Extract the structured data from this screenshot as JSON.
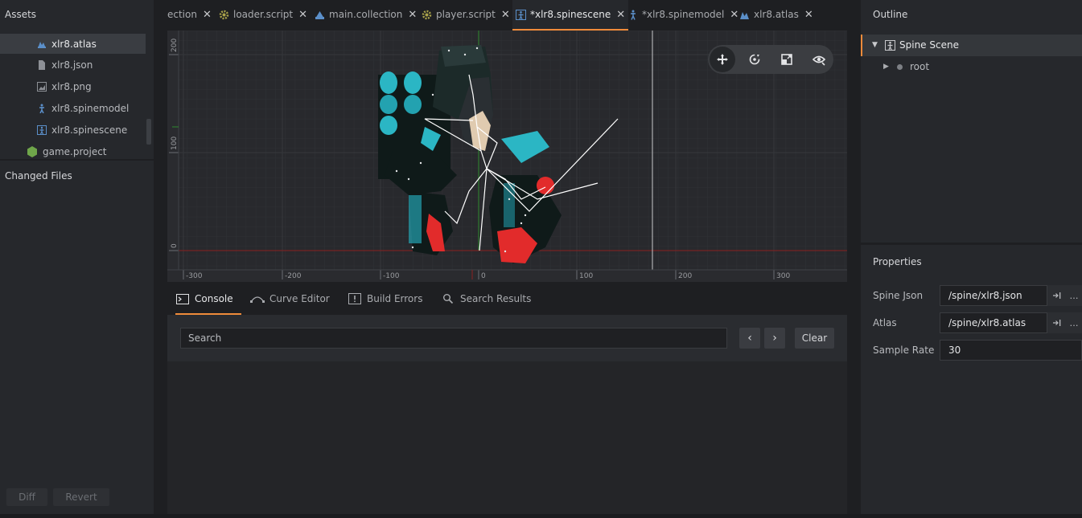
{
  "left": {
    "assets_title": "Assets",
    "items": [
      {
        "label": "xlr8.atlas",
        "icon": "atlas-icon",
        "selected": true
      },
      {
        "label": "xlr8.json",
        "icon": "file-icon"
      },
      {
        "label": "xlr8.png",
        "icon": "image-icon"
      },
      {
        "label": "xlr8.spinemodel",
        "icon": "spinemodel-icon"
      },
      {
        "label": "xlr8.spinescene",
        "icon": "spinescene-icon"
      },
      {
        "label": "game.project",
        "icon": "project-icon"
      }
    ],
    "changed_title": "Changed Files",
    "diff_label": "Diff",
    "revert_label": "Revert"
  },
  "tabs": [
    {
      "label": "ection",
      "icon": ""
    },
    {
      "label": "loader.script",
      "icon": "script-gear-icon"
    },
    {
      "label": "main.collection",
      "icon": "collection-icon"
    },
    {
      "label": "player.script",
      "icon": "script-gear-icon"
    },
    {
      "label": "*xlr8.spinescene",
      "icon": "spinescene-icon",
      "active": true
    },
    {
      "label": "*xlr8.spinemodel",
      "icon": "spinemodel-icon"
    },
    {
      "label": "xlr8.atlas",
      "icon": "atlas-icon"
    }
  ],
  "tab_close": "✕",
  "viewport": {
    "x_ticks": [
      "-300",
      "-200",
      "-100",
      "0",
      "100",
      "200",
      "300"
    ],
    "y_ticks": [
      "200",
      "100",
      "0"
    ]
  },
  "bottom_tabs": [
    {
      "label": "Console",
      "icon": "console-icon",
      "active": true
    },
    {
      "label": "Curve Editor",
      "icon": "curve-icon"
    },
    {
      "label": "Build Errors",
      "icon": "build-errors-icon"
    },
    {
      "label": "Search Results",
      "icon": "search-icon"
    }
  ],
  "console": {
    "search_placeholder": "Search",
    "prev": "‹",
    "next": "›",
    "clear_label": "Clear"
  },
  "outline": {
    "title": "Outline",
    "root_item": "Spine Scene",
    "child_item": "root"
  },
  "properties": {
    "title": "Properties",
    "spine_json_label": "Spine Json",
    "spine_json_value": "/spine/xlr8.json",
    "atlas_label": "Atlas",
    "atlas_value": "/spine/xlr8.atlas",
    "sample_rate_label": "Sample Rate",
    "sample_rate_value": "30",
    "more": "…"
  },
  "colors": {
    "accent": "#f08b3a",
    "icon_blue": "#5b8fc9",
    "icon_green": "#6fa64a",
    "teal": "#2bb6c4",
    "red": "#e22b2b"
  }
}
